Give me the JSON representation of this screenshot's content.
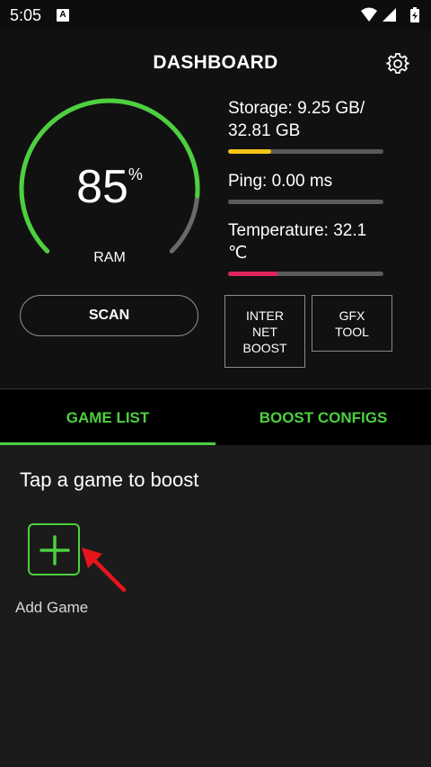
{
  "status_bar": {
    "time": "5:05",
    "notification_icon": "A"
  },
  "header": {
    "title": "DASHBOARD",
    "settings_icon": "gear-icon"
  },
  "ram_gauge": {
    "value": "85",
    "unit": "%",
    "label": "RAM",
    "fraction": 0.85
  },
  "stats": {
    "storage": {
      "label_line1": "Storage: 9.25 GB/",
      "label_line2": "32.81 GB",
      "fraction": 0.28,
      "color": "#f5c518"
    },
    "ping": {
      "label": "Ping: 0.00 ms",
      "fraction": 0.0,
      "color": "#4cd03e"
    },
    "temperature": {
      "label_line1": "Temperature: 32.1",
      "label_line2": "℃",
      "fraction": 0.32,
      "color": "#e0245e"
    }
  },
  "buttons": {
    "scan": "SCAN",
    "internet_boost": [
      "INTER",
      "NET",
      "BOOST"
    ],
    "gfx_tool": [
      "GFX",
      "TOOL"
    ]
  },
  "tabs": {
    "game_list": "GAME LIST",
    "boost_configs": "BOOST CONFIGS",
    "active": "game_list"
  },
  "main": {
    "hint": "Tap a game to boost",
    "add_game_label": "Add Game"
  },
  "colors": {
    "accent": "#4cd03e",
    "annotation_arrow": "#e8141b"
  }
}
